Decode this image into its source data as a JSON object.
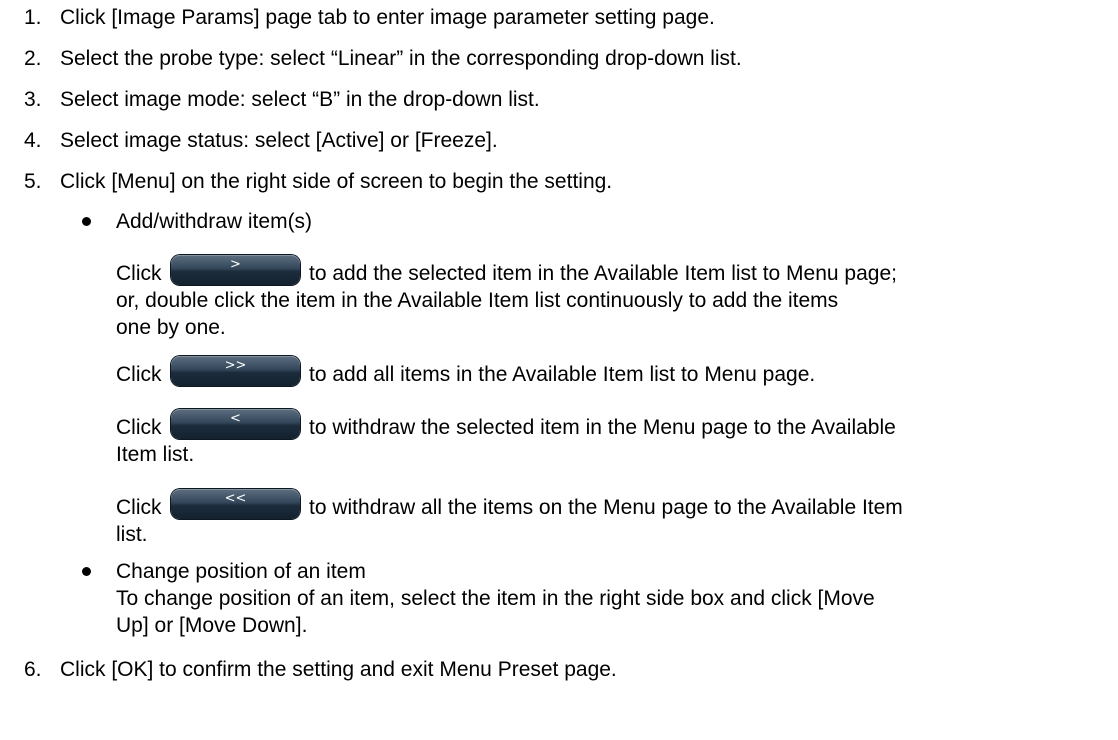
{
  "steps": [
    {
      "num": "1.",
      "text": "Click [Image Params] page tab to enter image parameter setting page."
    },
    {
      "num": "2.",
      "text": "Select the probe type: select “Linear” in the corresponding drop-down list."
    },
    {
      "num": "3.",
      "text": "Select image mode: select “B” in the drop-down list."
    },
    {
      "num": "4.",
      "text": "Select image status: select [Active] or [Freeze]."
    },
    {
      "num": "5.",
      "text": "Click [Menu] on the right side of screen to begin the setting."
    },
    {
      "num": "6.",
      "text": "Click [OK] to confirm the setting and exit Menu Preset page."
    }
  ],
  "bullet1": {
    "title": "Add/withdraw item(s)",
    "click_word": "Click",
    "add_selected": {
      "button_label": ">",
      "line1": "to add the selected item in the Available Item list to Menu page;",
      "line2": "or, double click the item in the Available Item list continuously to add the items",
      "line3": "one by one."
    },
    "add_all": {
      "button_label": ">>",
      "line1": "to add all items in the Available Item list to Menu page."
    },
    "withdraw_selected": {
      "button_label": "<",
      "line1": "to withdraw the selected item in the Menu page to the Available",
      "line2": "Item list."
    },
    "withdraw_all": {
      "button_label": "<<",
      "line1": "to withdraw all the items on the Menu page to the Available Item",
      "line2": "list."
    }
  },
  "bullet2": {
    "title": "Change position of an item",
    "line1": "To change position of an item, select the item in the right side box and click [Move",
    "line2": "Up] or [Move Down]."
  }
}
